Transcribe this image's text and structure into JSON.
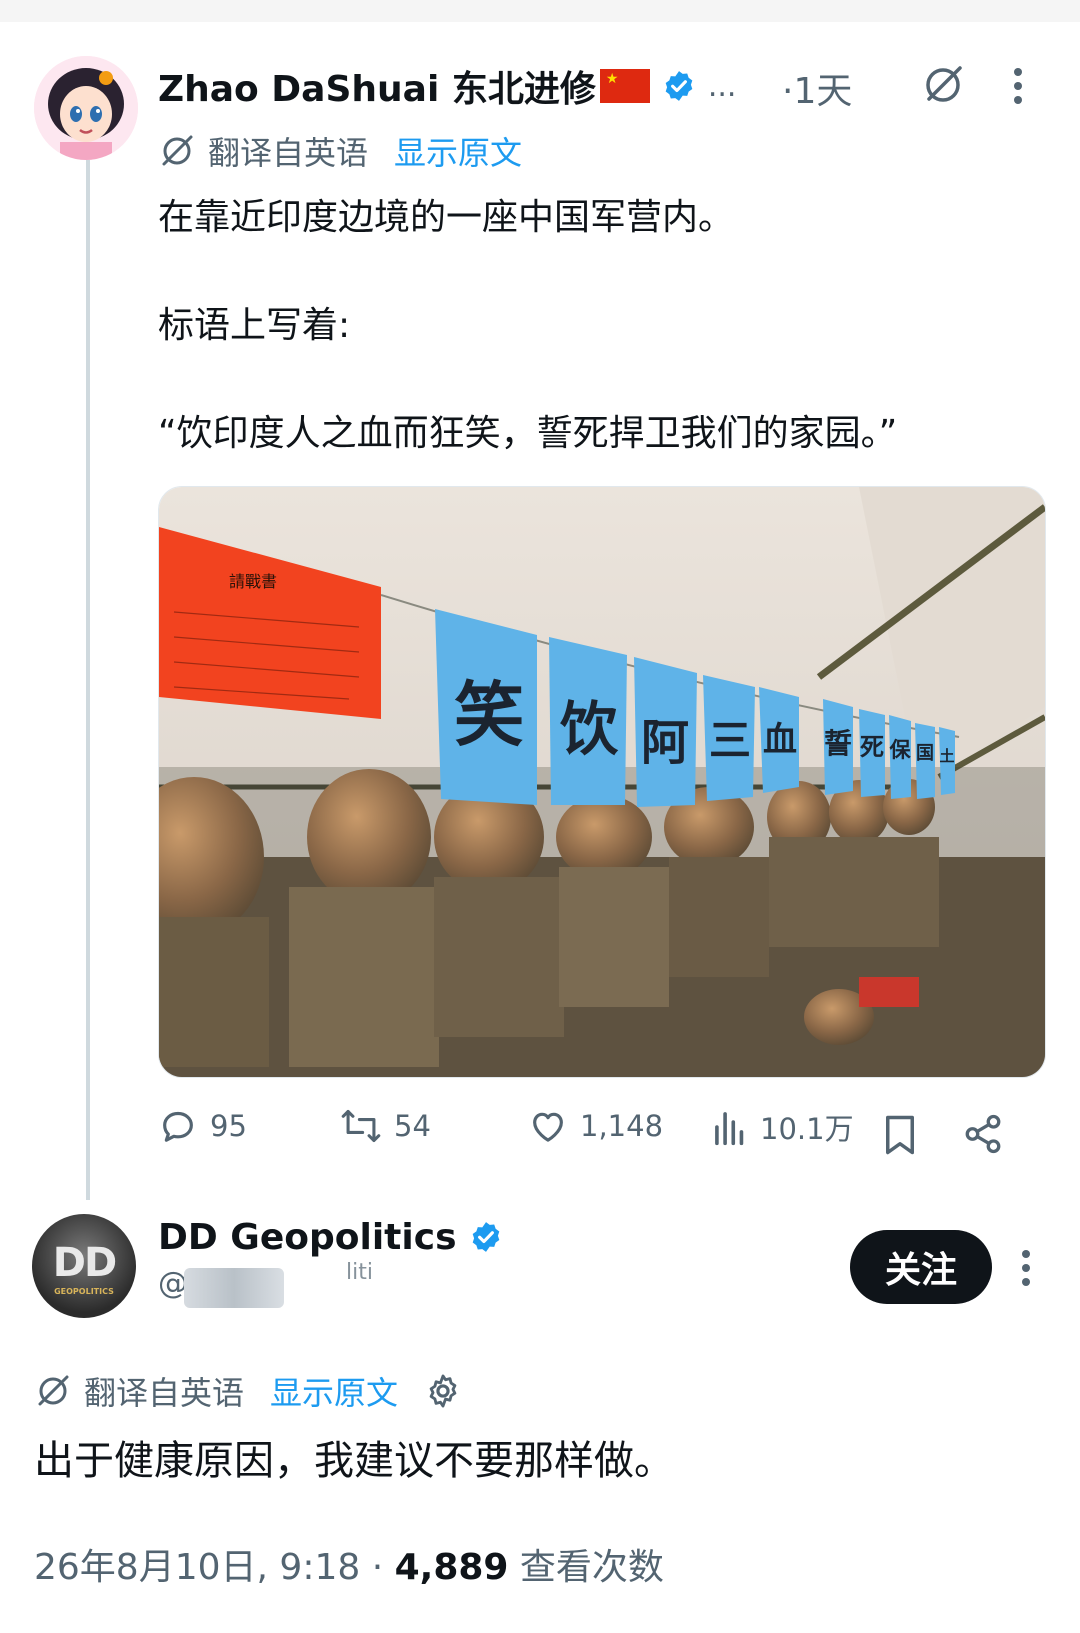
{
  "tweet": {
    "author_name": "Zhao DaShuai 东北进修",
    "overflow": "...",
    "time": "·1天",
    "translate_label": "翻译自英语",
    "show_original": "显示原文",
    "lines": [
      "在靠近印度边境的一座中国军营内。",
      "标语上写着:",
      "“饮印度人之血而狂笑，誓死捍卫我们的家园。”"
    ],
    "photo": {
      "banner_chars": [
        "笑",
        "饮",
        "阿",
        "三",
        "血",
        "誓",
        "死",
        "保",
        "国",
        "土"
      ],
      "paper_title": "請戰書"
    },
    "actions": {
      "replies": "95",
      "reposts": "54",
      "likes": "1,148",
      "views": "10.1万"
    }
  },
  "reply": {
    "author_name": "DD Geopolitics",
    "avatar_text": "DD",
    "avatar_sub": "GEOPOLITICS",
    "handle_prefix": "@",
    "handle_partial": "liti",
    "follow_label": "关注",
    "translate_label": "翻译自英语",
    "show_original": "显示原文",
    "body": "出于健康原因，我建议不要那样做。",
    "date": "26年8月10日, 9:18 · ",
    "view_count": "4,889",
    "view_label": " 查看次数"
  },
  "colors": {
    "link": "#1d9bf0",
    "verified": "#1d9bf0",
    "secondary_text": "#536471",
    "primary_text": "#0f1419",
    "banner": "#5fb3e8",
    "paper": "#f2431f"
  },
  "icons": [
    "verified-icon",
    "grok-icon",
    "more-icon",
    "translate-icon",
    "reply-icon",
    "repost-icon",
    "like-icon",
    "views-icon",
    "bookmark-icon",
    "share-icon",
    "settings-icon"
  ]
}
